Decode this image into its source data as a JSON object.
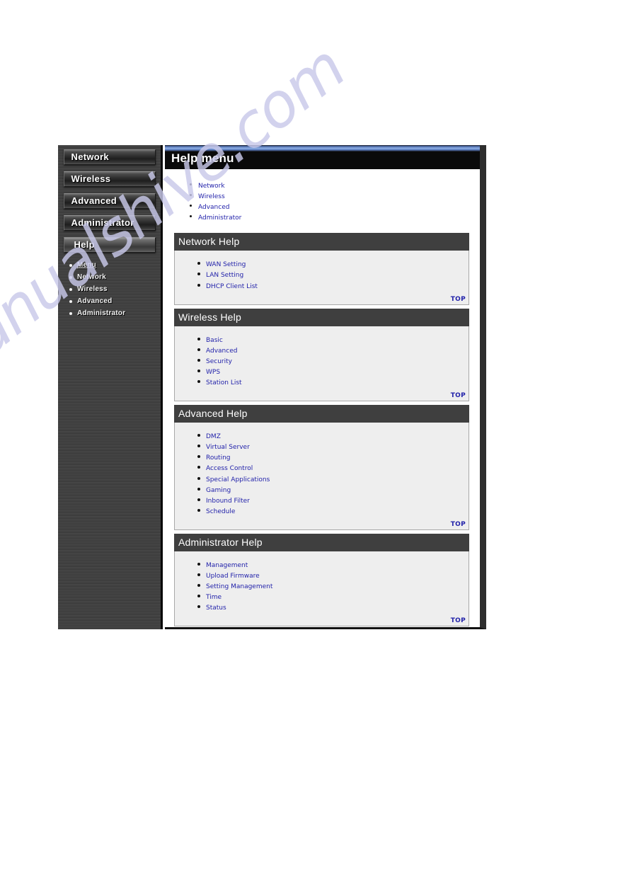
{
  "watermark": {
    "text": "manualshive.com"
  },
  "sidebar": {
    "buttons": [
      {
        "label": "Network",
        "active": false
      },
      {
        "label": "Wireless",
        "active": false
      },
      {
        "label": "Advanced",
        "active": false
      },
      {
        "label": "Administrator",
        "active": false
      },
      {
        "label": "Help",
        "active": true
      }
    ],
    "submenu": [
      {
        "label": "Menu",
        "current": true
      },
      {
        "label": "Network",
        "current": false
      },
      {
        "label": "Wireless",
        "current": false
      },
      {
        "label": "Advanced",
        "current": false
      },
      {
        "label": "Administrator",
        "current": false
      }
    ]
  },
  "header": {
    "title": "Help menu"
  },
  "intro": {
    "items": [
      "Network",
      "Wireless",
      "Advanced",
      "Administrator"
    ]
  },
  "top_label": "TOP",
  "sections": [
    {
      "title": "Network Help",
      "items": [
        "WAN Setting",
        "LAN Setting",
        "DHCP Client List"
      ]
    },
    {
      "title": "Wireless Help",
      "items": [
        "Basic",
        "Advanced",
        "Security",
        "WPS",
        "Station List"
      ]
    },
    {
      "title": "Advanced Help",
      "items": [
        "DMZ",
        "Virtual Server",
        "Routing",
        "Access Control",
        "Special Applications",
        "Gaming",
        "Inbound Filter",
        "Schedule"
      ]
    },
    {
      "title": "Administrator Help",
      "items": [
        "Management",
        "Upload Firmware",
        "Setting Management",
        "Time",
        "Status"
      ]
    }
  ],
  "colors": {
    "link": "#2222aa",
    "panel_head_bg": "#3f3f3f",
    "panel_body_bg": "#eeeeee",
    "titlebar_bg": "#0a0a0a",
    "titlebar_accent": "#8fb0e6",
    "sidebar_bg": "#404040",
    "watermark": "#c9c9ea"
  }
}
